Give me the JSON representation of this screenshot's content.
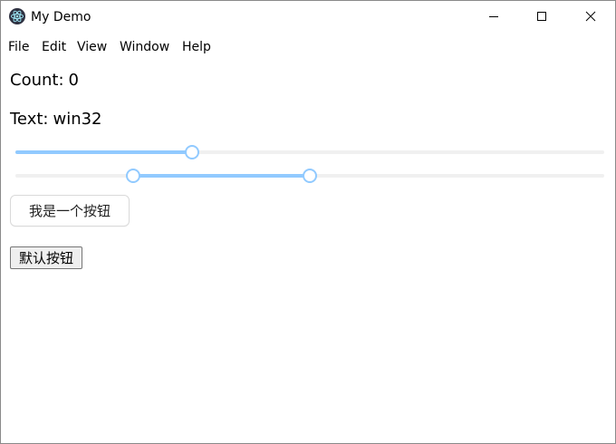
{
  "window": {
    "title": "My Demo"
  },
  "menu": {
    "items": [
      "File",
      "Edit",
      "View",
      "Window",
      "Help"
    ]
  },
  "count": {
    "label": "Count:",
    "value": "0"
  },
  "text": {
    "label": "Text:",
    "value": "win32"
  },
  "slider_single": {
    "value_fraction": 0.3
  },
  "slider_range": {
    "low_fraction": 0.2,
    "high_fraction": 0.5
  },
  "buttons": {
    "primary_label": "我是一个按钮",
    "default_label": "默认按钮"
  },
  "colors": {
    "slider_track": "#91caff",
    "slider_rail": "#f0f0f0",
    "app_icon_bg": "#2f3242"
  },
  "icons": {
    "app": "electron-atom-icon",
    "minimize": "minimize-icon",
    "maximize": "maximize-icon",
    "close": "close-icon"
  }
}
